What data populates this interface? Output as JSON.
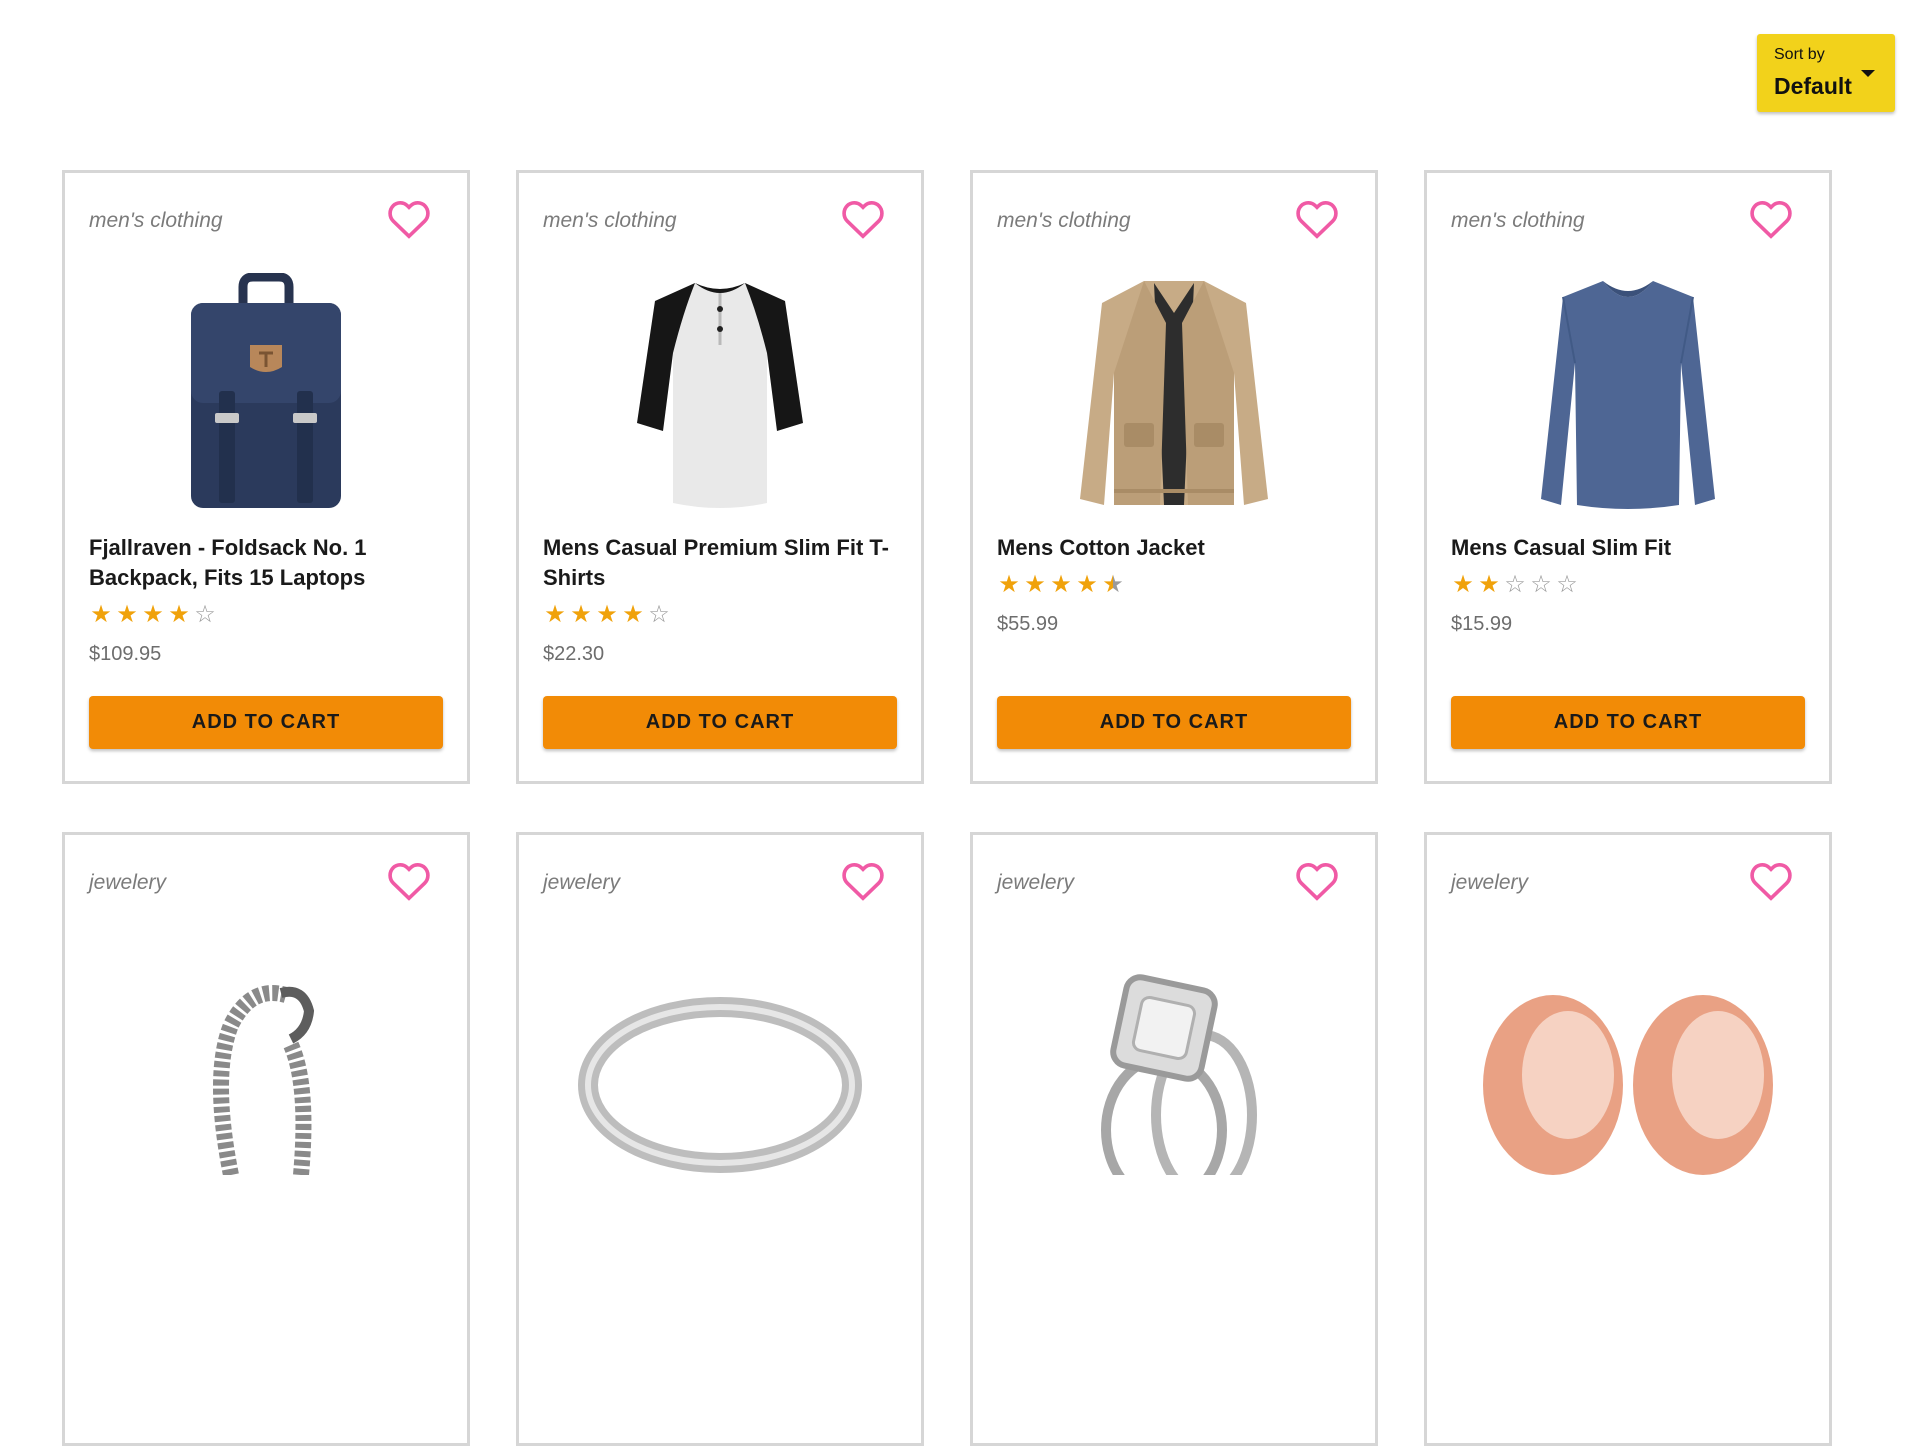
{
  "sort": {
    "label": "Sort by",
    "value": "Default"
  },
  "colors": {
    "heart": "#f05aa5",
    "star": "#f0a20b",
    "cart_button": "#f28b06",
    "sort_button": "#f2d21b"
  },
  "products": [
    {
      "category": "men's clothing",
      "title": "Fjallraven - Foldsack No. 1 Backpack, Fits 15 Laptops",
      "rating": 4,
      "price": "$109.95",
      "button": "ADD TO CART",
      "image": "backpack"
    },
    {
      "category": "men's clothing",
      "title": "Mens Casual Premium Slim Fit T-Shirts",
      "rating": 4,
      "price": "$22.30",
      "button": "ADD TO CART",
      "image": "raglan-tshirt"
    },
    {
      "category": "men's clothing",
      "title": "Mens Cotton Jacket",
      "rating": 4.5,
      "price": "$55.99",
      "button": "ADD TO CART",
      "image": "cotton-jacket"
    },
    {
      "category": "men's clothing",
      "title": "Mens Casual Slim Fit",
      "rating": 2,
      "price": "$15.99",
      "button": "ADD TO CART",
      "image": "long-sleeve-shirt"
    },
    {
      "category": "jewelery",
      "title": "",
      "rating": null,
      "price": "",
      "button": "",
      "image": "chain-bracelet"
    },
    {
      "category": "jewelery",
      "title": "",
      "rating": null,
      "price": "",
      "button": "",
      "image": "silver-ring"
    },
    {
      "category": "jewelery",
      "title": "",
      "rating": null,
      "price": "",
      "button": "",
      "image": "diamond-ring"
    },
    {
      "category": "jewelery",
      "title": "",
      "rating": null,
      "price": "",
      "button": "",
      "image": "rose-gold-plugs"
    }
  ]
}
